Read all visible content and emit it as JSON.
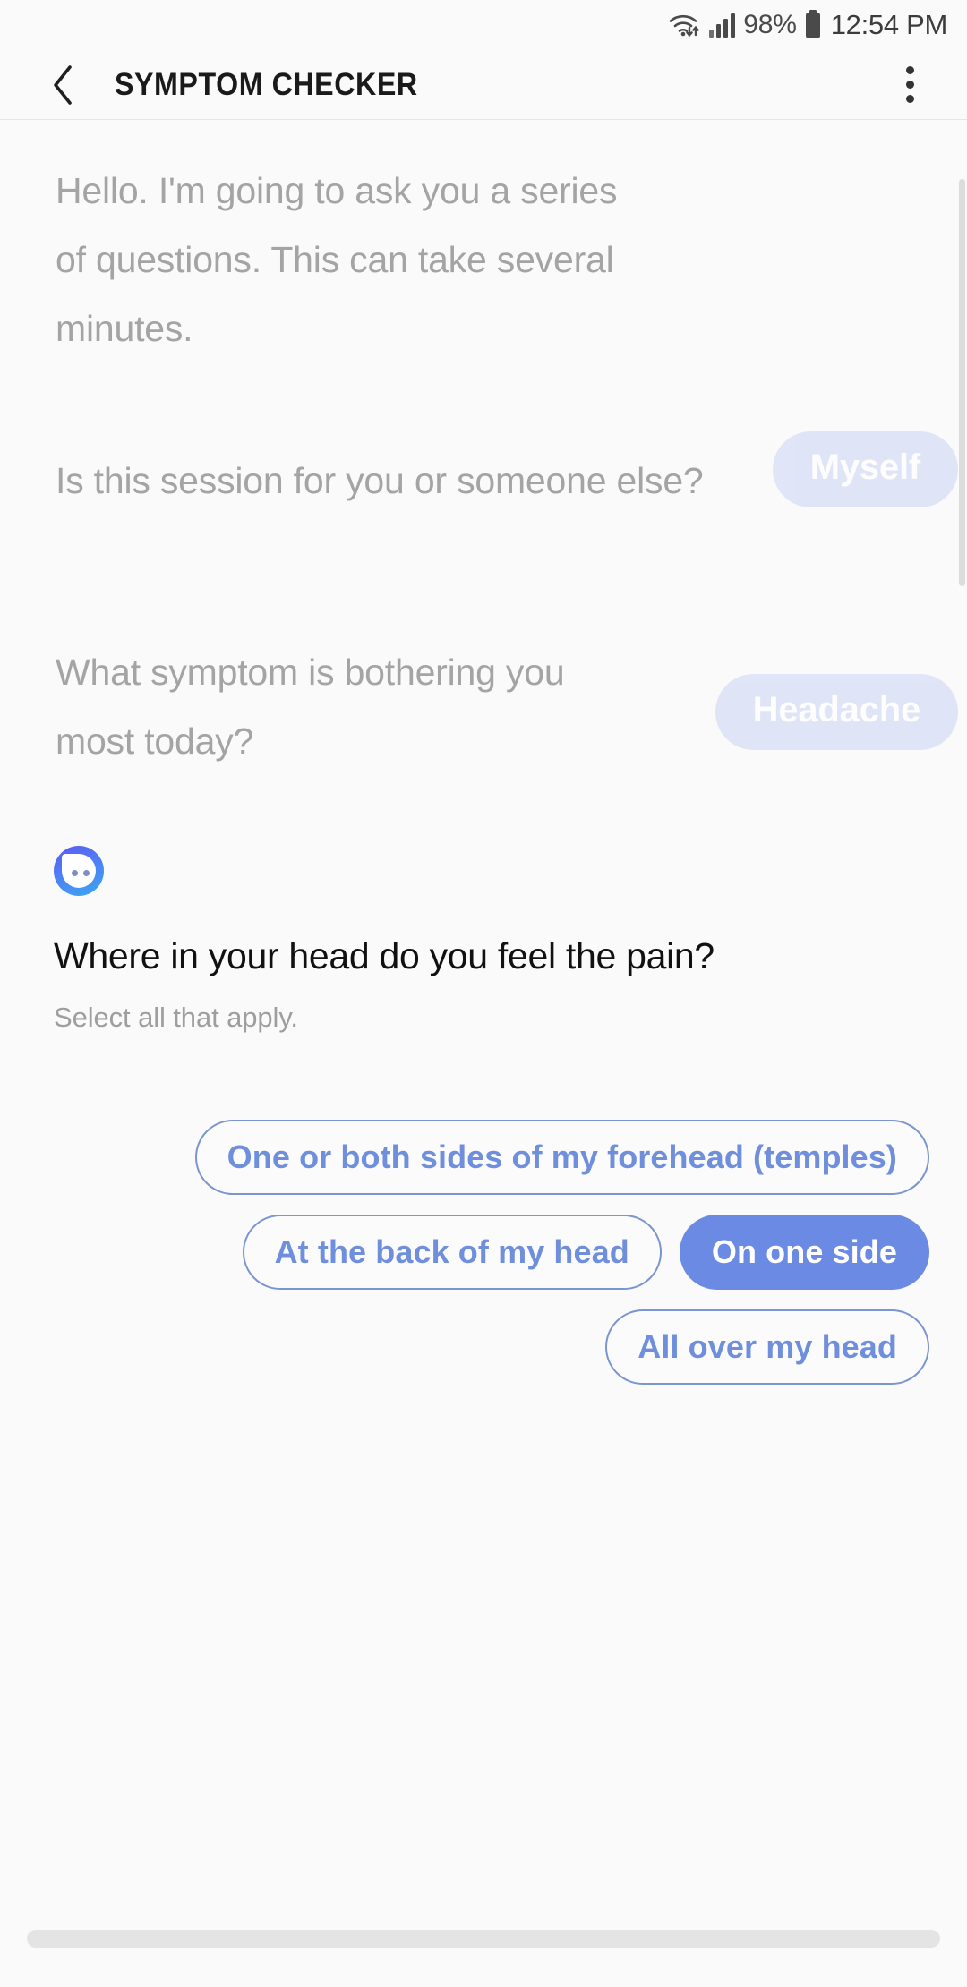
{
  "colors": {
    "background": "#fafafa",
    "accent": "#6b8ae4",
    "chip_outline": "#7b95cf",
    "chip_text": "#6f8fdc",
    "bot_text_faded": "#a4a4a4",
    "bubble_faded": "#d6dcf5",
    "avatar_gradient_start": "#5a5cf0",
    "avatar_gradient_end": "#3aa8f0"
  },
  "status_bar": {
    "wifi_icon": "wifi-icon",
    "data_transfer_icon": "upload-download-arrows-icon",
    "signal_icon": "cellular-signal-icon",
    "battery_percent": "98%",
    "battery_icon": "battery-full-icon",
    "clock": "12:54 PM"
  },
  "app_bar": {
    "back_icon": "chevron-left-icon",
    "title": "SYMPTOM CHECKER",
    "overflow_icon": "more-vertical-icon"
  },
  "conversation": {
    "messages": [
      {
        "sender": "bot",
        "text": "Hello. I'm going to ask you a series of questions. This can take several minutes."
      },
      {
        "sender": "bot",
        "text": "Is this session for you or someone else?"
      },
      {
        "sender": "user",
        "text": "Myself"
      },
      {
        "sender": "bot",
        "text": "What symptom is bothering you most today?"
      },
      {
        "sender": "user",
        "text": "Headache"
      }
    ]
  },
  "active_question": {
    "avatar_icon": "chat-bot-avatar-icon",
    "title": "Where in your head do you feel the pain?",
    "subtitle": "Select all that apply.",
    "options": [
      {
        "label": "One or both sides of my forehead (temples)",
        "selected": false
      },
      {
        "label": "At the back of my head",
        "selected": false
      },
      {
        "label": "On one side",
        "selected": true
      },
      {
        "label": "All over my head",
        "selected": false
      }
    ]
  },
  "scrollbars": {
    "vertical_icon": "vertical-scrollbar",
    "horizontal_icon": "horizontal-scrollbar"
  }
}
